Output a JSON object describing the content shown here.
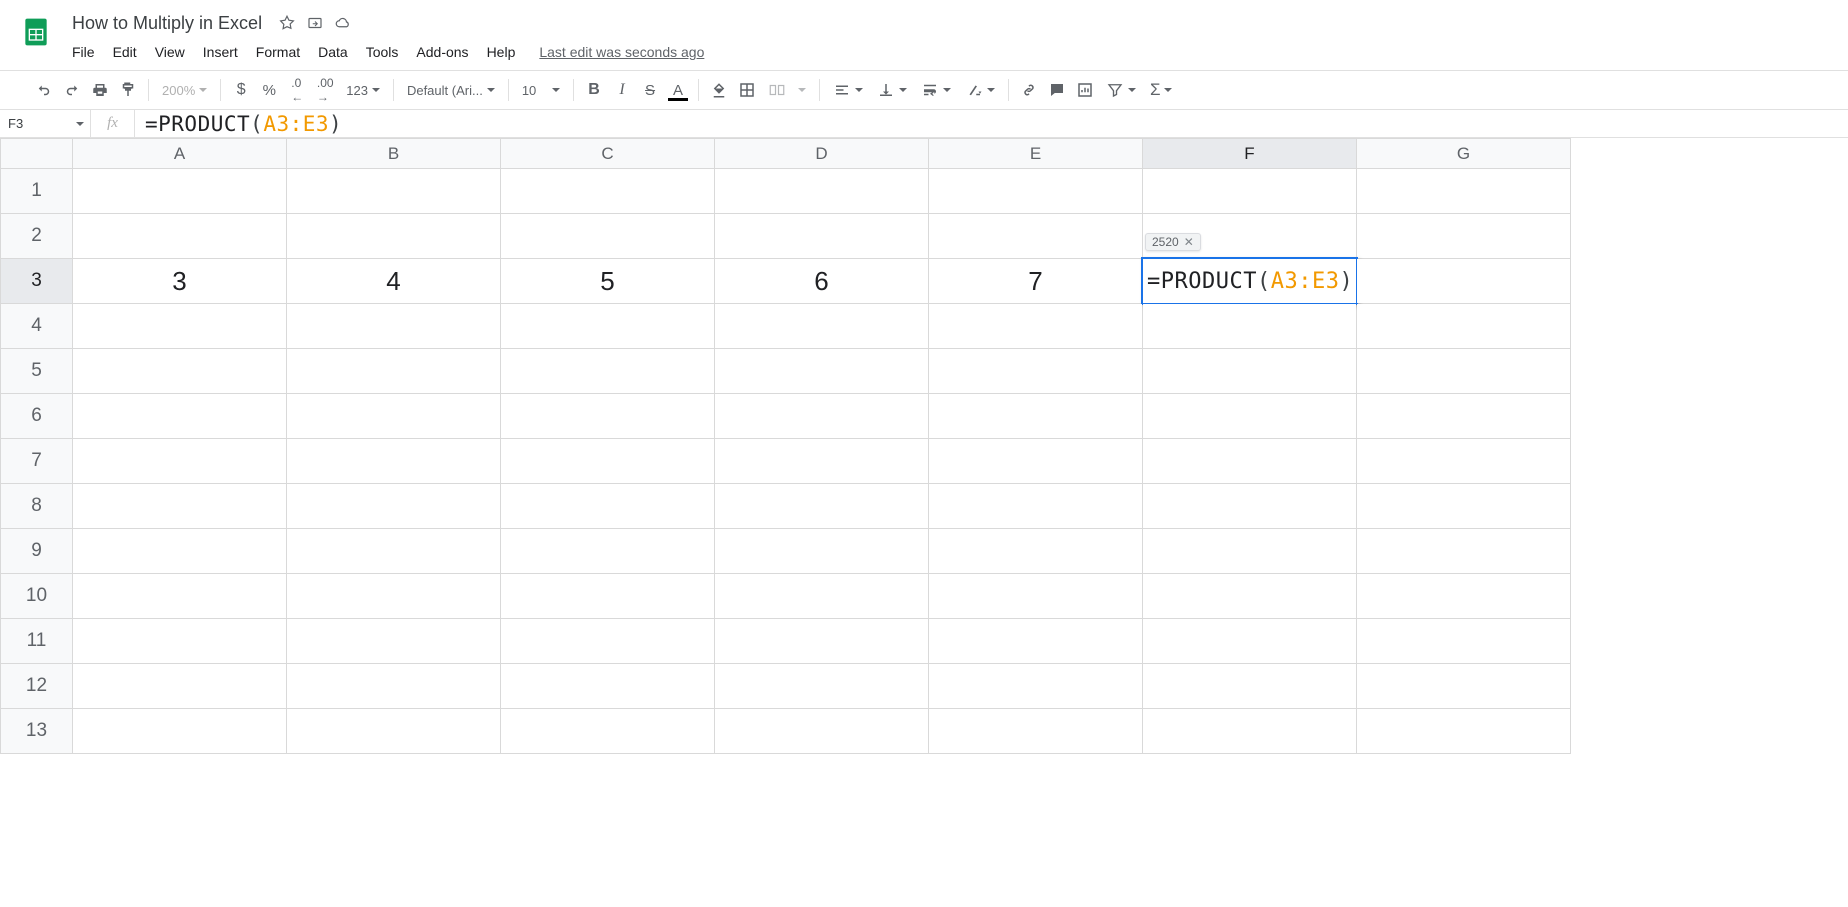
{
  "doc": {
    "title": "How to Multiply in Excel",
    "last_edit": "Last edit was seconds ago"
  },
  "menu": [
    "File",
    "Edit",
    "View",
    "Insert",
    "Format",
    "Data",
    "Tools",
    "Add-ons",
    "Help"
  ],
  "toolbar": {
    "zoom": "200%",
    "font": "Default (Ari...",
    "size": "10",
    "format_123": "123"
  },
  "namebox": "F3",
  "formula": {
    "prefix": "=PRODUCT",
    "lp": "(",
    "range": "A3:E3",
    "rp": ")"
  },
  "columns": [
    "A",
    "B",
    "C",
    "D",
    "E",
    "F",
    "G"
  ],
  "rows": [
    "1",
    "2",
    "3",
    "4",
    "5",
    "6",
    "7",
    "8",
    "9",
    "10",
    "11",
    "12",
    "13"
  ],
  "cells": {
    "A3": "3",
    "B3": "4",
    "C3": "5",
    "D3": "6",
    "E3": "7"
  },
  "edit": {
    "prefix": "=PRODUCT",
    "lp": "(",
    "range": "A3:E3",
    "rp": ")",
    "result": "2520"
  }
}
